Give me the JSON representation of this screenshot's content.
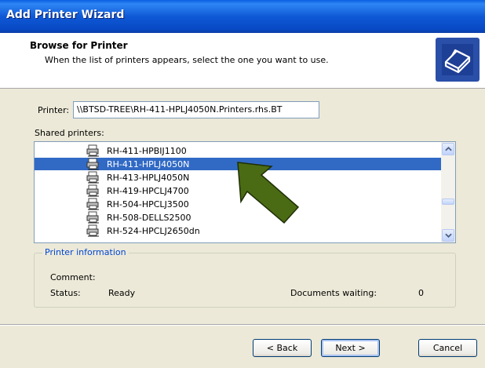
{
  "window": {
    "title": "Add Printer Wizard"
  },
  "header": {
    "title": "Browse for Printer",
    "subtitle": "When the list of printers appears, select the one you want to use."
  },
  "printer_field": {
    "label": "Printer:",
    "value": "\\\\BTSD-TREE\\RH-411-HPLJ4050N.Printers.rhs.BT"
  },
  "shared_printers": {
    "label": "Shared printers:",
    "items": [
      {
        "name": "RH-411-HPBIJ1100",
        "selected": false
      },
      {
        "name": "RH-411-HPLJ4050N",
        "selected": true
      },
      {
        "name": "RH-413-HPLJ4050N",
        "selected": false
      },
      {
        "name": "RH-419-HPCLJ4700",
        "selected": false
      },
      {
        "name": "RH-504-HPCLJ3500",
        "selected": false
      },
      {
        "name": "RH-508-DELLS2500",
        "selected": false
      },
      {
        "name": "RH-524-HPCLJ2650dn",
        "selected": false
      }
    ]
  },
  "printer_information": {
    "legend": "Printer information",
    "comment_label": "Comment:",
    "comment_value": "",
    "status_label": "Status:",
    "status_value": "Ready",
    "documents_label": "Documents waiting:",
    "documents_value": "0"
  },
  "buttons": {
    "back": "< Back",
    "next": "Next >",
    "cancel": "Cancel"
  },
  "colors": {
    "selection": "#316AC5",
    "annotation_arrow": "#4A6B14"
  }
}
